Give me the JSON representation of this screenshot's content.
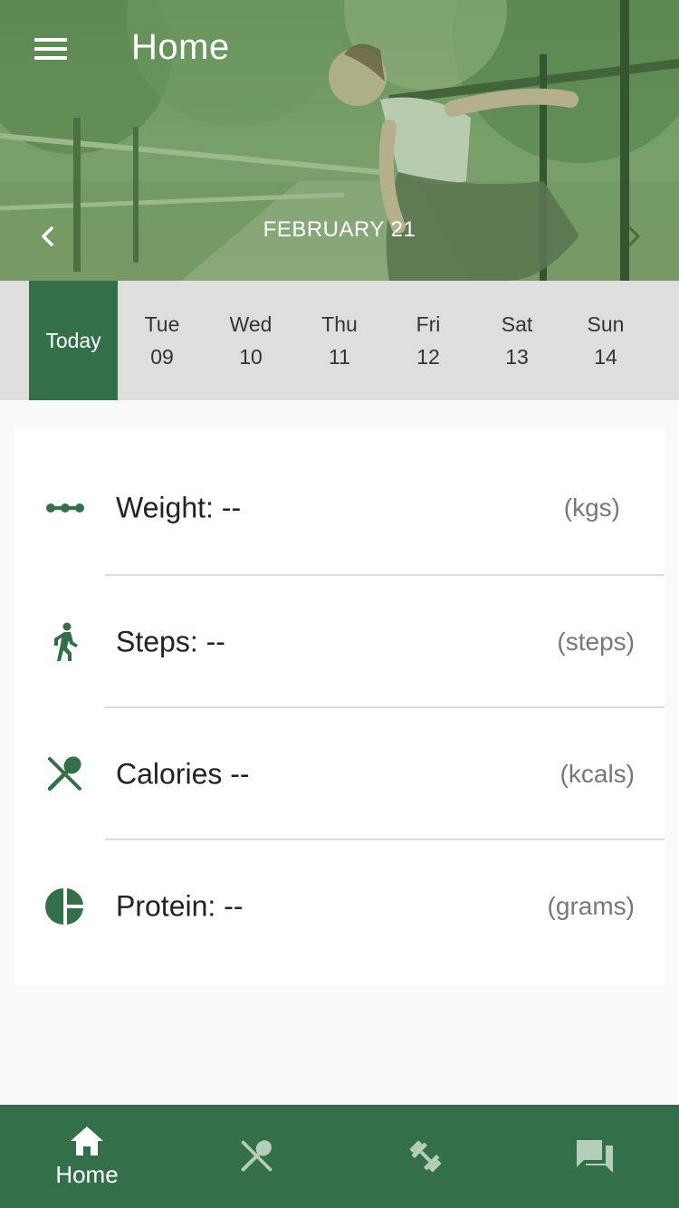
{
  "header": {
    "title": "Home",
    "month": "FEBRUARY 21"
  },
  "week": [
    {
      "line1": "Today",
      "line2": "",
      "selected": true
    },
    {
      "line1": "Tue",
      "line2": "09",
      "selected": false
    },
    {
      "line1": "Wed",
      "line2": "10",
      "selected": false
    },
    {
      "line1": "Thu",
      "line2": "11",
      "selected": false
    },
    {
      "line1": "Fri",
      "line2": "12",
      "selected": false
    },
    {
      "line1": "Sat",
      "line2": "13",
      "selected": false
    },
    {
      "line1": "Sun",
      "line2": "14",
      "selected": false
    }
  ],
  "metrics": [
    {
      "icon": "weight-icon",
      "label": "Weight: --",
      "unit": "(kgs)"
    },
    {
      "icon": "walking-icon",
      "label": "Steps: --",
      "unit": "(steps)"
    },
    {
      "icon": "utensils-icon",
      "label": "Calories --",
      "unit": "(kcals)"
    },
    {
      "icon": "pie-chart-icon",
      "label": "Protein: --",
      "unit": "(grams)"
    }
  ],
  "bottom_nav": [
    {
      "icon": "home-icon",
      "label": "Home",
      "active": true
    },
    {
      "icon": "utensils-icon",
      "label": "",
      "active": false
    },
    {
      "icon": "dumbbell-icon",
      "label": "",
      "active": false
    },
    {
      "icon": "chat-icon",
      "label": "",
      "active": false
    }
  ],
  "colors": {
    "primary": "#33704a",
    "date_strip": "#dedede",
    "background": "#fafafa",
    "inactive_nav_icon": "#b5cdb9"
  }
}
